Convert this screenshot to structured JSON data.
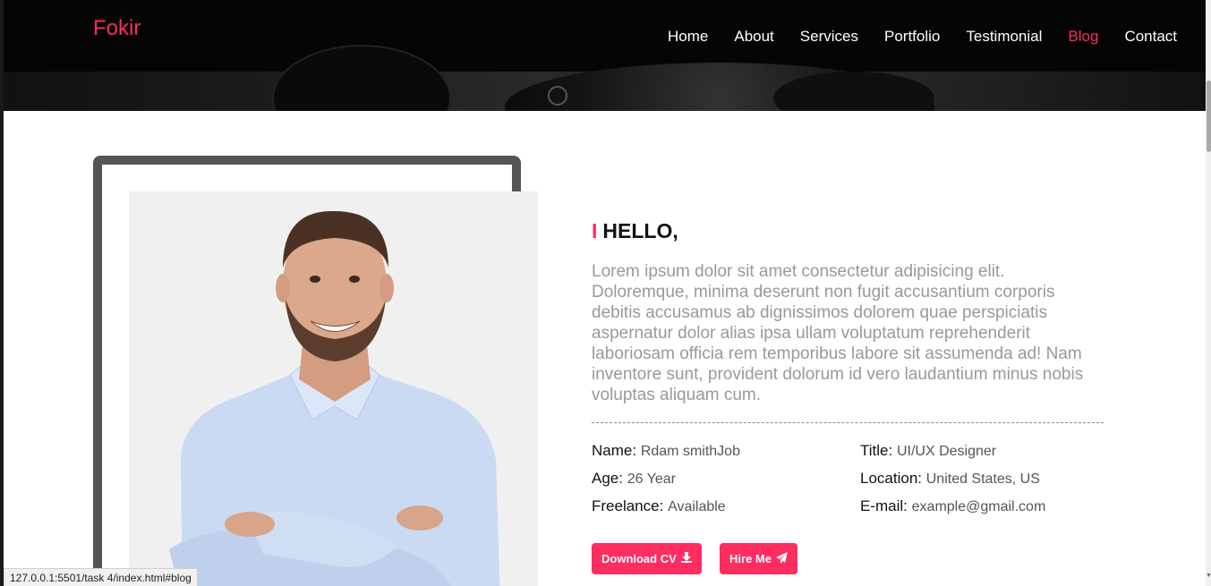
{
  "header": {
    "logo": "Fokir",
    "nav": [
      {
        "label": "Home",
        "active": false
      },
      {
        "label": "About",
        "active": false
      },
      {
        "label": "Services",
        "active": false
      },
      {
        "label": "Portfolio",
        "active": false
      },
      {
        "label": "Testimonial",
        "active": false
      },
      {
        "label": "Blog",
        "active": true
      },
      {
        "label": "Contact",
        "active": false
      }
    ]
  },
  "about": {
    "heading_marker": "I",
    "heading": "HELLO,",
    "paragraph": "Lorem ipsum dolor sit amet consectetur adipisicing elit. Doloremque, minima deserunt non fugit accusantium corporis debitis accusamus ab dignissimos dolorem quae perspiciatis aspernatur dolor alias ipsa ullam voluptatum reprehenderit laboriosam officia rem temporibus labore sit assumenda ad! Nam inventore sunt, provident dolorum id vero laudantium minus nobis voluptas aliquam cum.",
    "info": {
      "name_label": "Name:",
      "name_value": "Rdam smithJob",
      "title_label": "Title:",
      "title_value": "UI/UX Designer",
      "age_label": "Age:",
      "age_value": "26 Year",
      "location_label": "Location:",
      "location_value": "United States, US",
      "freelance_label": "Freelance:",
      "freelance_value": "Available",
      "email_label": "E-mail:",
      "email_value": "example@gmail.com"
    },
    "download_label": "Download CV",
    "hire_label": "Hire Me"
  },
  "status_bar": {
    "url": "127.0.0.1:5501/task 4/index.html#blog"
  },
  "colors": {
    "accent": "#ff2c5f",
    "header_bg": "#050505",
    "frame": "#555555"
  },
  "icons": {
    "download": "download-icon",
    "hire": "paper-plane-icon"
  }
}
